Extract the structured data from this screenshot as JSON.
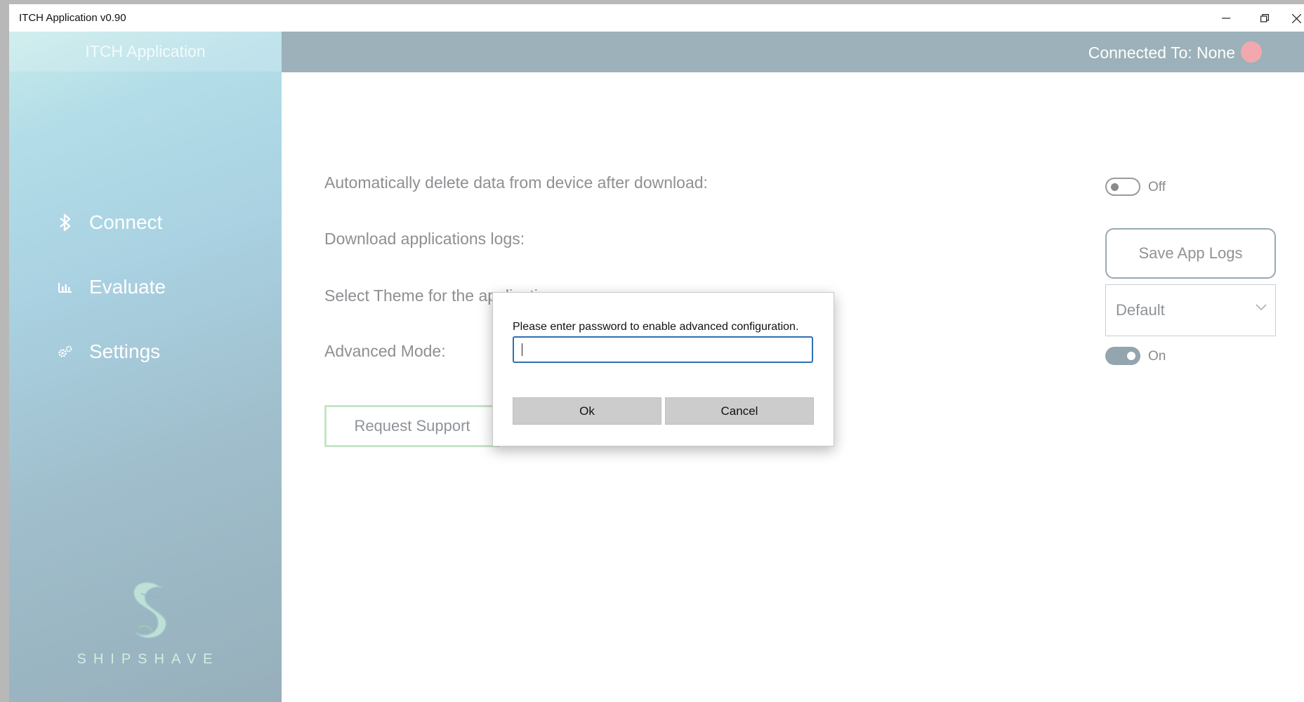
{
  "window": {
    "title": "ITCH Application v0.90"
  },
  "sidebar": {
    "app_title": "ITCH Application",
    "items": [
      {
        "label": "Connect",
        "icon": "bluetooth-icon"
      },
      {
        "label": "Evaluate",
        "icon": "chart-icon"
      },
      {
        "label": "Settings",
        "icon": "gears-icon"
      }
    ],
    "logo_text": "SHIPSHAVE"
  },
  "header": {
    "connection_label": "Connected To: None",
    "status_color": "#f3a8ae"
  },
  "settings": {
    "auto_delete_label": "Automatically delete data from device after download:",
    "auto_delete_state": "Off",
    "download_logs_label": "Download applications logs:",
    "save_logs_button": "Save App Logs",
    "theme_label": "Select Theme for the application:",
    "theme_value": "Default",
    "advanced_label": "Advanced Mode:",
    "advanced_state": "On",
    "request_support_button": "Request Support"
  },
  "dialog": {
    "prompt": "Please enter password to enable advanced configuration.",
    "password_value": "",
    "ok_label": "Ok",
    "cancel_label": "Cancel"
  },
  "colors": {
    "accent": "#9cb1b9",
    "focus": "#2f6fb8",
    "support_border": "#c5e6c7"
  }
}
